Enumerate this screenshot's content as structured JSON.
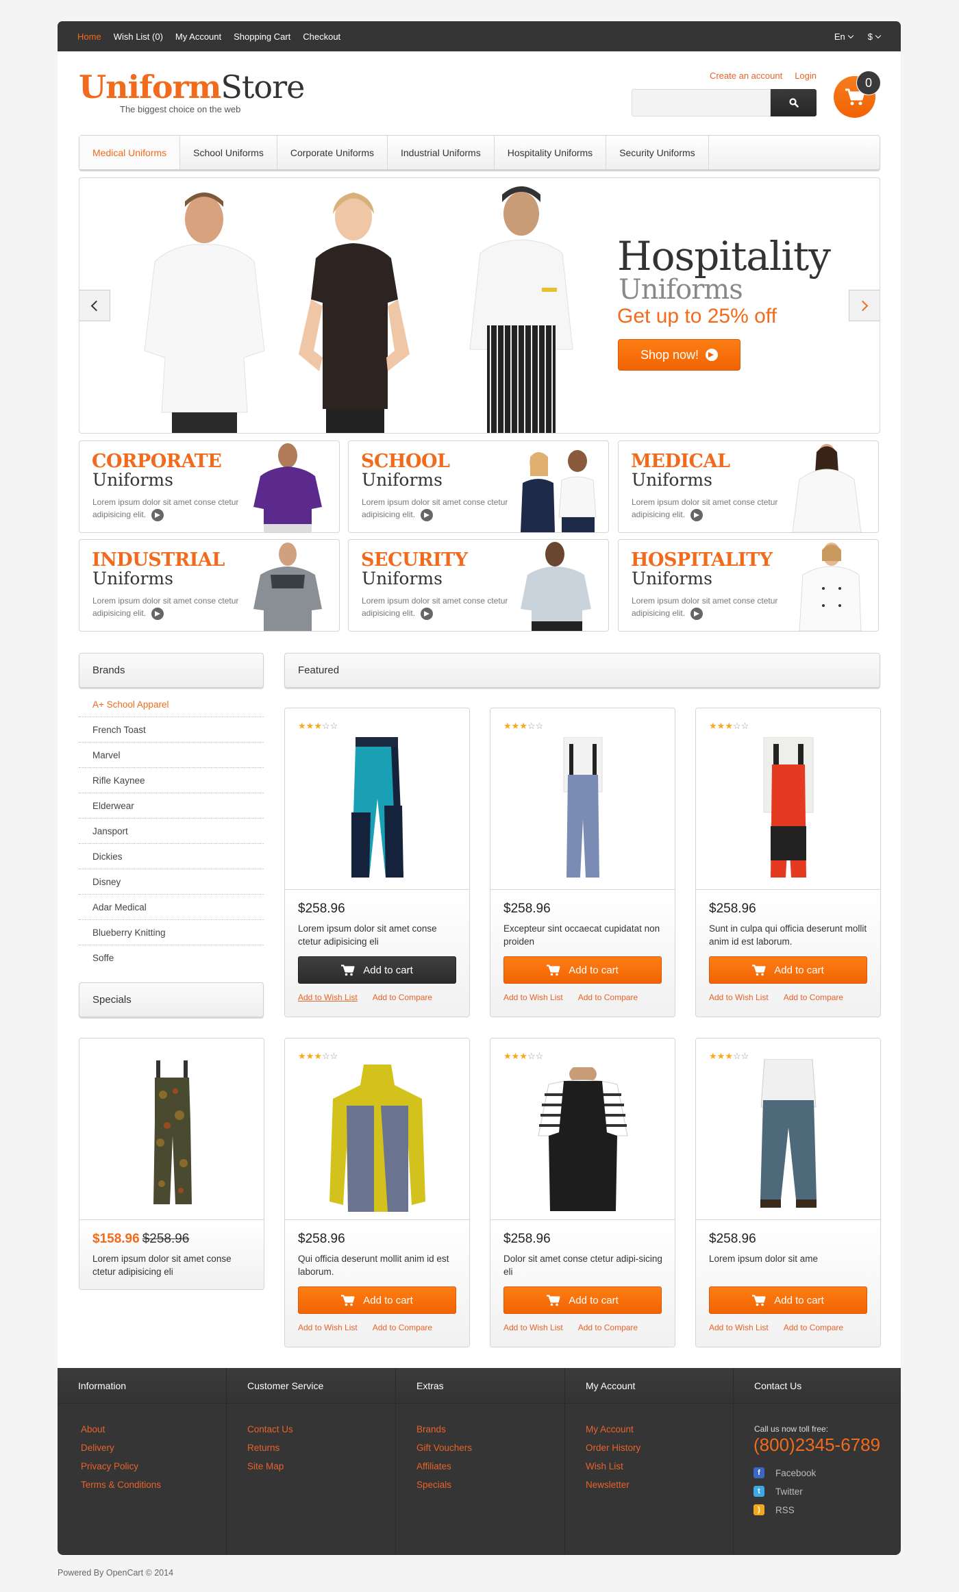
{
  "topbar": {
    "nav": [
      "Home",
      "Wish List (0)",
      "My Account",
      "Shopping Cart",
      "Checkout"
    ],
    "language": "En",
    "currency": "$"
  },
  "header": {
    "logo_bold": "Uniform",
    "logo_light": "Store",
    "tagline": "The biggest choice on the web",
    "create_account": "Create an account",
    "login": "Login",
    "search_placeholder": "",
    "cart_count": "0"
  },
  "menu": [
    "Medical Uniforms",
    "School Uniforms",
    "Corporate Uniforms",
    "Industrial Uniforms",
    "Hospitality Uniforms",
    "Security Uniforms"
  ],
  "slider": {
    "title": "Hospitality",
    "subtitle": "Uniforms",
    "offer": "Get up to 25% off",
    "button": "Shop now!"
  },
  "banners": [
    {
      "title": "CORPORATE",
      "sub": "Uniforms",
      "desc": "Lorem ipsum dolor sit amet conse ctetur adipisicing elit."
    },
    {
      "title": "SCHOOL",
      "sub": "Uniforms",
      "desc": "Lorem ipsum dolor sit amet conse ctetur adipisicing elit."
    },
    {
      "title": "MEDICAL",
      "sub": "Uniforms",
      "desc": "Lorem ipsum dolor sit amet conse ctetur adipisicing elit."
    },
    {
      "title": "INDUSTRIAL",
      "sub": "Uniforms",
      "desc": "Lorem ipsum dolor sit amet conse ctetur adipisicing elit."
    },
    {
      "title": "SECURITY",
      "sub": "Uniforms",
      "desc": "Lorem ipsum dolor sit amet conse ctetur adipisicing elit."
    },
    {
      "title": "HOSPITALITY",
      "sub": "Uniforms",
      "desc": "Lorem ipsum dolor sit amet conse ctetur adipisicing elit."
    }
  ],
  "sidebar": {
    "brands_title": "Brands",
    "brands": [
      "A+ School Apparel",
      "French Toast",
      "Marvel",
      "Rifle Kaynee",
      "Elderwear",
      "Jansport",
      "Dickies",
      "Disney",
      "Adar Medical",
      "Blueberry Knitting",
      "Soffe"
    ],
    "specials_title": "Specials",
    "special": {
      "price_new": "$158.96",
      "price_old": "$258.96",
      "desc": "Lorem ipsum dolor sit amet conse ctetur adipisicing eli"
    }
  },
  "featured": {
    "title": "Featured",
    "add_to_cart": "Add to cart",
    "wishlist": "Add to Wish List",
    "compare": "Add to Compare",
    "products": [
      {
        "price": "$258.96",
        "desc": "Lorem ipsum dolor sit amet conse ctetur adipisicing eli",
        "rating": 3,
        "image": "teal-work-pants"
      },
      {
        "price": "$258.96",
        "desc": "Excepteur sint occaecat cupidatat non proiden",
        "rating": 3,
        "image": "denim-overalls"
      },
      {
        "price": "$258.96",
        "desc": "Sunt in culpa qui officia deserunt mollit anim id est laborum.",
        "rating": 3,
        "image": "red-bib-overalls"
      },
      {
        "price": "$258.96",
        "desc": "Qui officia deserunt mollit anim id est laborum.",
        "rating": 3,
        "image": "yellow-rain-jacket"
      },
      {
        "price": "$258.96",
        "desc": "Dolor sit amet conse ctetur adipi-sicing eli",
        "rating": 3,
        "image": "black-apron"
      },
      {
        "price": "$258.96",
        "desc": "Lorem ipsum dolor sit ame",
        "rating": 3,
        "image": "jeans"
      }
    ]
  },
  "footer": {
    "columns": [
      {
        "title": "Information",
        "links": [
          "About",
          "Delivery",
          "Privacy Policy",
          "Terms & Conditions"
        ]
      },
      {
        "title": "Customer Service",
        "links": [
          "Contact Us",
          "Returns",
          "Site Map"
        ]
      },
      {
        "title": "Extras",
        "links": [
          "Brands",
          "Gift Vouchers",
          "Affiliates",
          "Specials"
        ]
      },
      {
        "title": "My Account",
        "links": [
          "My Account",
          "Order History",
          "Wish List",
          "Newsletter"
        ]
      }
    ],
    "contact_title": "Contact Us",
    "call_label": "Call us now toll free:",
    "phone": "(800)2345-6789",
    "social": [
      "Facebook",
      "Twitter",
      "RSS"
    ],
    "powered": "Powered By OpenCart © 2014"
  },
  "colors": {
    "accent": "#f26a1b",
    "dark": "#353535",
    "facebook": "#3b67c4",
    "twitter": "#3fa9e6",
    "rss": "#f2a81d"
  }
}
